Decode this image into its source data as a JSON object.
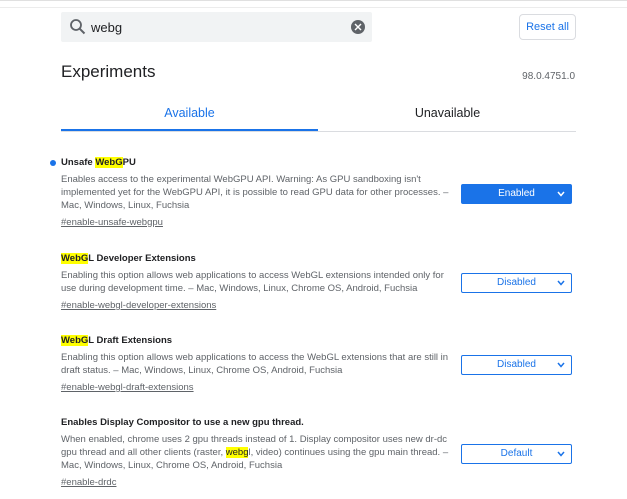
{
  "search": {
    "value": "webg",
    "placeholder": ""
  },
  "header": {
    "reset_label": "Reset all",
    "title": "Experiments",
    "version": "98.0.4751.0"
  },
  "tabs": [
    {
      "label": "Available"
    },
    {
      "label": "Unavailable"
    }
  ],
  "experiments": [
    {
      "title_pre": "Unsafe ",
      "title_hl": "WebG",
      "title_post": "PU",
      "description": "Enables access to the experimental WebGPU API. Warning: As GPU sandboxing isn't implemented yet for the WebGPU API, it is possible to read GPU data for other processes. – Mac, Windows, Linux, Fuchsia",
      "link": "#enable-unsafe-webgpu",
      "state": "Enabled"
    },
    {
      "title_pre": "",
      "title_hl": "WebG",
      "title_post": "L Developer Extensions",
      "description": "Enabling this option allows web applications to access WebGL extensions intended only for use during development time. – Mac, Windows, Linux, Chrome OS, Android, Fuchsia",
      "link": "#enable-webgl-developer-extensions",
      "state": "Disabled"
    },
    {
      "title_pre": "",
      "title_hl": "WebG",
      "title_post": "L Draft Extensions",
      "description": "Enabling this option allows web applications to access the WebGL extensions that are still in draft status. – Mac, Windows, Linux, Chrome OS, Android, Fuchsia",
      "link": "#enable-webgl-draft-extensions",
      "state": "Disabled"
    },
    {
      "title": "Enables Display Compositor to use a new gpu thread.",
      "desc_pre": "When enabled, chrome uses 2 gpu threads instead of 1. Display compositor uses new dr-dc gpu thread and all other clients (raster, ",
      "desc_hl": "webg",
      "desc_post": "l, video) continues using the gpu main thread. – Mac, Windows, Linux, Chrome OS, Android, Fuchsia",
      "link": "#enable-drdc",
      "state": "Default"
    }
  ],
  "icons": {
    "search": "search-icon",
    "clear": "clear-icon",
    "chevron": "chevron-down-icon",
    "modified_dot": "modified-indicator-icon"
  },
  "colors": {
    "accent": "#1a73e8",
    "highlight": "#ffff00",
    "text": "#202124",
    "muted": "#5f6368"
  }
}
